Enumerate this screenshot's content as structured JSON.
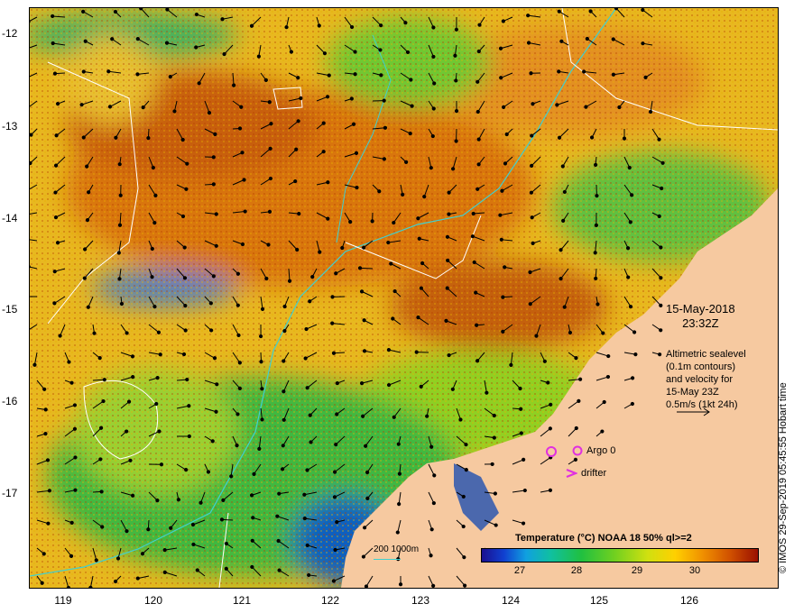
{
  "map": {
    "lat_labels": [
      "-12",
      "-13",
      "-14",
      "-15",
      "-16",
      "-17"
    ],
    "lon_labels": [
      "119",
      "120",
      "121",
      "122",
      "123",
      "124",
      "125",
      "126"
    ],
    "timestamp_line1": "15-May-2018",
    "timestamp_line2": "23:32Z",
    "altimetry_note": [
      "Altimetric sealevel",
      "(0.1m contours)",
      "and velocity for",
      "15-May 23Z",
      "0.5m/s (1kt 24h)"
    ],
    "argo_label": "Argo 0",
    "drifter_label": "drifter",
    "colorbar_title": "Temperature (°C) NOAA 18 50% ql>=2",
    "colorbar_ticks": [
      "27",
      "28",
      "29",
      "30"
    ],
    "depth_legend": "200  1000m",
    "credit": "© IMOS 29-Sep-2019 05:45:55 Hobart time",
    "colors": {
      "land": "#f6c9a0",
      "warm": "#d06a10",
      "cool": "#30c030",
      "argo": "#e030e0",
      "drifter": "#e030e0",
      "isobath": "#40d0d0"
    }
  }
}
